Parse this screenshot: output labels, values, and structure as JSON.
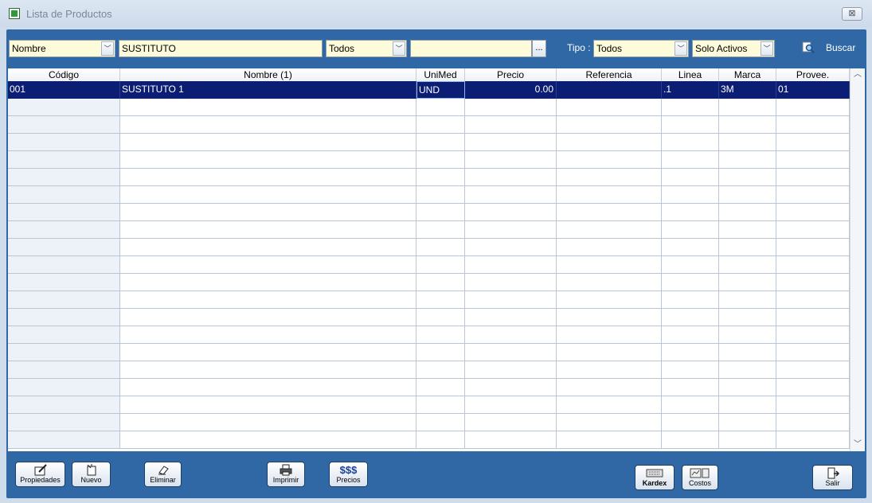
{
  "window": {
    "title": "Lista de Productos",
    "close_label": "⊠"
  },
  "search": {
    "field_selector": "Nombre",
    "search_text": "SUSTITUTO",
    "filter_selector": "Todos",
    "filter_value": "",
    "dots_label": "...",
    "tipo_label": "Tipo :",
    "tipo_value": "Todos",
    "status_value": "Solo Activos",
    "buscar_label": "Buscar"
  },
  "table": {
    "columns": [
      "Código",
      "Nombre (1)",
      "UniMed",
      "Precio",
      "Referencia",
      "Linea",
      "Marca",
      "Provee."
    ],
    "rows": [
      [
        "001",
        "SUSTITUTO 1",
        "UND",
        "0.00",
        "",
        ".1",
        "3M",
        "01"
      ]
    ]
  },
  "buttons": {
    "propiedades": "Propiedades",
    "nuevo": "Nuevo",
    "eliminar": "Eliminar",
    "imprimir": "Imprimir",
    "precios_icon": "$$$",
    "precios": "Precios",
    "kardex": "Kardex",
    "costos": "Costos",
    "salir": "Salir"
  },
  "icons": {
    "propiedades": "edit-doc-icon",
    "nuevo": "new-doc-icon",
    "eliminar": "eraser-icon",
    "imprimir": "printer-icon",
    "kardex": "keyboard-icon",
    "costos": "chart-icon",
    "salir": "exit-door-icon",
    "buscar": "search-icon"
  },
  "colors": {
    "panel": "#2f68a4",
    "selected_row": "#0b1e74",
    "input_bg": "#fdfbd9"
  }
}
